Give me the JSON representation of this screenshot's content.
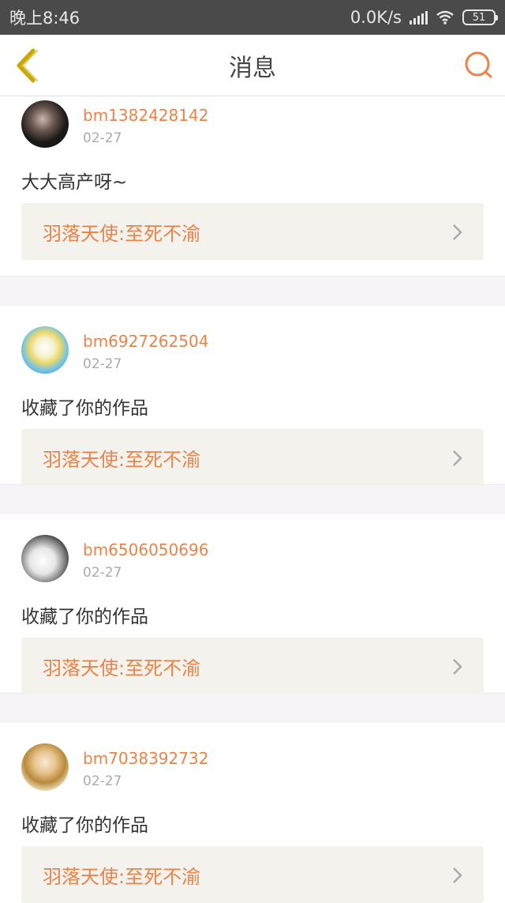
{
  "status": {
    "time": "晚上8:46",
    "speed": "0.0K/s",
    "battery": "51"
  },
  "header": {
    "title": "消息"
  },
  "messages": [
    {
      "username": "bm1382428142",
      "date": "02-27",
      "text": "大大高产呀~",
      "work": "羽落天使:至死不渝"
    },
    {
      "username": "bm6927262504",
      "date": "02-27",
      "text": "收藏了你的作品",
      "work": "羽落天使:至死不渝"
    },
    {
      "username": "bm6506050696",
      "date": "02-27",
      "text": "收藏了你的作品",
      "work": "羽落天使:至死不渝"
    },
    {
      "username": "bm7038392732",
      "date": "02-27",
      "text": "收藏了你的作品",
      "work": "羽落天使:至死不渝"
    }
  ],
  "colors": {
    "accent": "#e8834a",
    "back_arrow": "#c9a800",
    "card_bg": "#f3f2ec"
  }
}
